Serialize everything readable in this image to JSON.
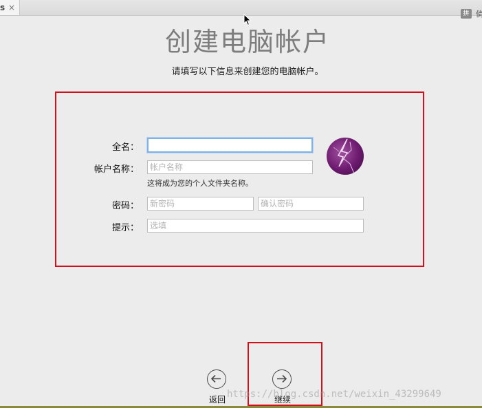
{
  "tab": {
    "text": "s",
    "close": "×"
  },
  "top_right": {
    "badge": "拼",
    "char": "倘"
  },
  "header": {
    "title": "创建电脑帐户",
    "subtitle": "请填写以下信息来创建您的电脑帐户。"
  },
  "form": {
    "full_name": {
      "label": "全名：",
      "value": ""
    },
    "account_name": {
      "label": "帐户名称：",
      "placeholder": "帐户名称",
      "hint": "这将成为您的个人文件夹名称。"
    },
    "password": {
      "label": "密码：",
      "placeholder": "新密码",
      "confirm_placeholder": "确认密码"
    },
    "password_hint": {
      "label": "提示：",
      "placeholder": "选填"
    },
    "avatar_icon": "lightning-avatar-icon"
  },
  "navigation": {
    "back_label": "返回",
    "continue_label": "继续"
  },
  "watermark": "https://blog.csdn.net/weixin_43299649",
  "colors": {
    "highlight": "#d0101a",
    "focus": "#7fb0e6",
    "title": "#7d7d7d"
  }
}
